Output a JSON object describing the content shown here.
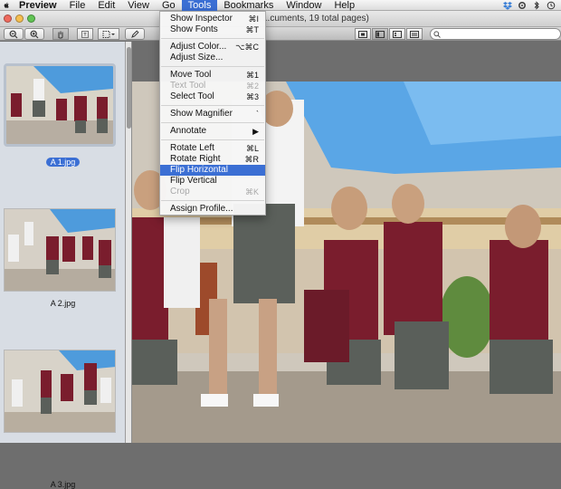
{
  "menubar": {
    "app_name": "Preview",
    "items": [
      "File",
      "Edit",
      "View",
      "Go",
      "Tools",
      "Bookmarks",
      "Window",
      "Help"
    ],
    "active_item": "Tools"
  },
  "window": {
    "title": "...cuments, 19 total pages)"
  },
  "search": {
    "placeholder": ""
  },
  "sidebar": {
    "thumbnails": [
      {
        "label": "A 1.jpg",
        "selected": true
      },
      {
        "label": "A 2.jpg",
        "selected": false
      },
      {
        "label": "A 3.jpg",
        "selected": false
      }
    ]
  },
  "tools_menu": {
    "items": [
      {
        "label": "Show Inspector",
        "shortcut": "⌘I",
        "disabled": false
      },
      {
        "label": "Show Fonts",
        "shortcut": "⌘T",
        "disabled": false
      },
      {
        "label": "Adjust Color...",
        "shortcut": "⌥⌘C",
        "disabled": false
      },
      {
        "label": "Adjust Size...",
        "shortcut": "",
        "disabled": false
      },
      {
        "label": "Move Tool",
        "shortcut": "⌘1",
        "disabled": false
      },
      {
        "label": "Text Tool",
        "shortcut": "⌘2",
        "disabled": true
      },
      {
        "label": "Select Tool",
        "shortcut": "⌘3",
        "disabled": false
      },
      {
        "label": "Show Magnifier",
        "shortcut": "`",
        "disabled": false
      },
      {
        "label": "Annotate",
        "shortcut": "▶",
        "disabled": false
      },
      {
        "label": "Rotate Left",
        "shortcut": "⌘L",
        "disabled": false
      },
      {
        "label": "Rotate Right",
        "shortcut": "⌘R",
        "disabled": false
      },
      {
        "label": "Flip Horizontal",
        "shortcut": "",
        "disabled": false,
        "highlighted": true
      },
      {
        "label": "Flip Vertical",
        "shortcut": "",
        "disabled": false
      },
      {
        "label": "Crop",
        "shortcut": "⌘K",
        "disabled": true
      },
      {
        "label": "Assign Profile...",
        "shortcut": "",
        "disabled": false
      }
    ]
  },
  "colors": {
    "selection": "#3b6fd4",
    "sky": "#5aa6e6",
    "blazer": "#7a1d2d",
    "shorts": "#5a5f5a"
  }
}
